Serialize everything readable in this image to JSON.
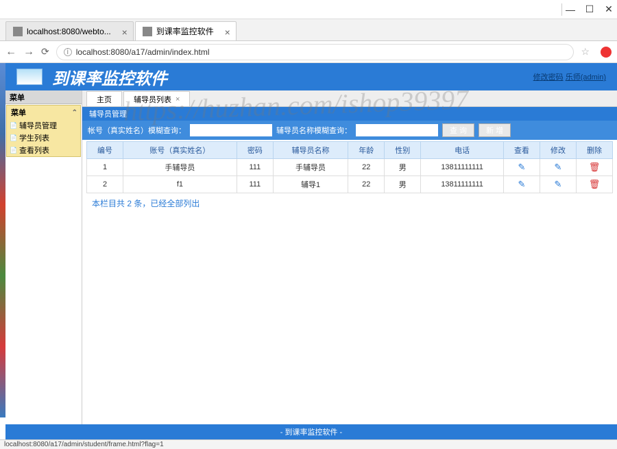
{
  "window": {
    "minimize": "—",
    "maximize": "☐",
    "close": "✕"
  },
  "browser": {
    "tabs": [
      {
        "title": "localhost:8080/webto...",
        "active": false
      },
      {
        "title": "到课率监控软件",
        "active": true
      }
    ],
    "url": "localhost:8080/a17/admin/index.html"
  },
  "header": {
    "app_title": "到课率监控软件",
    "link_change_pwd": "修改密码",
    "link_user": "乐师(admin)"
  },
  "sidebar": {
    "header": "菜单",
    "group_title": "菜单",
    "items": [
      {
        "label": "辅导员管理"
      },
      {
        "label": "学生列表"
      },
      {
        "label": "查看列表"
      }
    ]
  },
  "page_tabs": [
    {
      "label": "主页",
      "closable": false
    },
    {
      "label": "辅导员列表",
      "closable": true,
      "active": true
    }
  ],
  "subnav": {
    "label": "辅导员管理"
  },
  "search": {
    "label1": "帐号（真实姓名）模糊查询：",
    "label2": "辅导员名称模糊查询：",
    "btn_search": "查 询",
    "btn_add": "新 增"
  },
  "table": {
    "headers": [
      "编号",
      "账号（真实姓名）",
      "密码",
      "辅导员名称",
      "年龄",
      "性别",
      "电话",
      "查看",
      "修改",
      "删除"
    ],
    "rows": [
      {
        "id": "1",
        "account": "手辅导员",
        "password": "111",
        "name": "手辅导员",
        "age": "22",
        "gender": "男",
        "phone": "13811111111"
      },
      {
        "id": "2",
        "account": "f1",
        "password": "111",
        "name": "辅导1",
        "age": "22",
        "gender": "男",
        "phone": "13811111111"
      }
    ],
    "summary": "本栏目共 2 条，已经全部列出"
  },
  "footer": {
    "text": "- 到课率监控软件 -"
  },
  "status_bar": {
    "text": "localhost:8080/a17/admin/student/frame.html?flag=1"
  },
  "watermark": "https://huzhan.com/ishop39397"
}
